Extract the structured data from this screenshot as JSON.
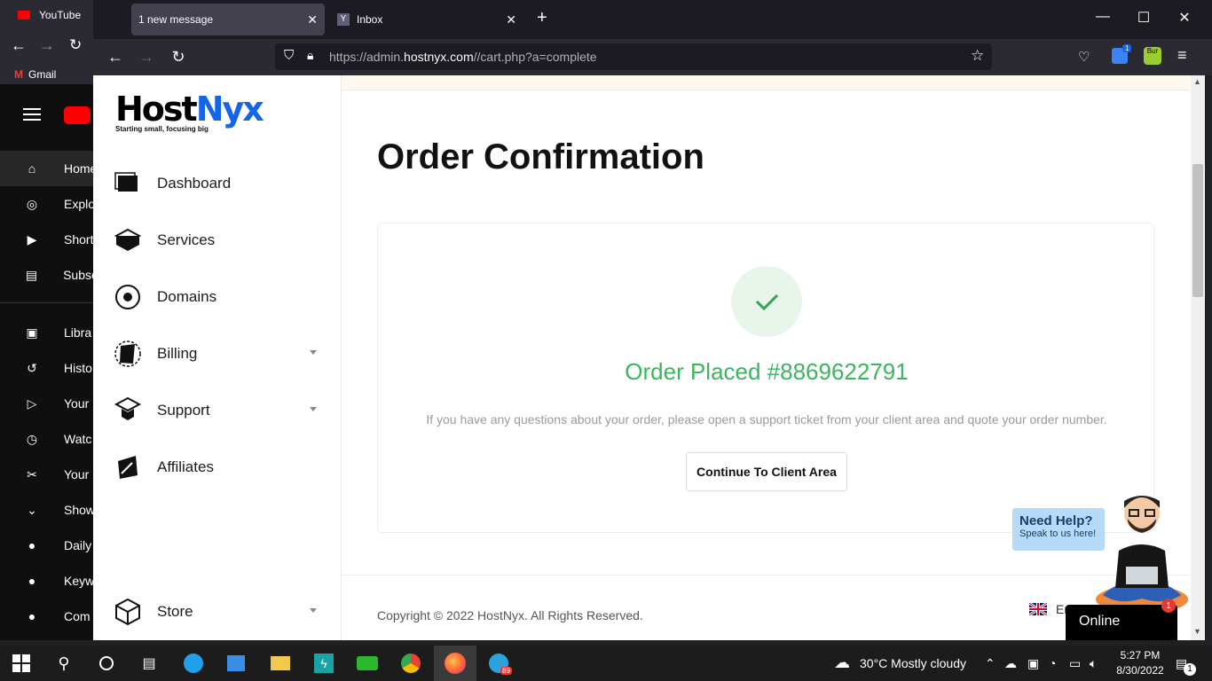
{
  "youtube": {
    "tab_label": "YouTube",
    "bookmark": "Gmail",
    "nav": [
      {
        "label": "Home",
        "icon": "home-icon"
      },
      {
        "label": "Explo",
        "icon": "compass-icon"
      },
      {
        "label": "Short",
        "icon": "shorts-icon"
      },
      {
        "label": "Subsc",
        "icon": "subscriptions-icon"
      },
      {
        "label": "Libra",
        "icon": "library-icon"
      },
      {
        "label": "Histo",
        "icon": "history-icon"
      },
      {
        "label": "Your",
        "icon": "play-icon"
      },
      {
        "label": "Watc",
        "icon": "clock-icon"
      },
      {
        "label": "Your",
        "icon": "scissors-icon"
      },
      {
        "label": "Show",
        "icon": "chevron-down-icon"
      },
      {
        "label": "Daily",
        "icon": "channel-icon"
      },
      {
        "label": "Keyw",
        "icon": "channel-icon"
      },
      {
        "label": "Com",
        "icon": "channel-icon"
      }
    ]
  },
  "browser": {
    "tabs": [
      {
        "label": "1 new message",
        "active": true
      },
      {
        "label": "Inbox",
        "active": false
      }
    ],
    "url_prefix": "https://admin.",
    "url_domain": "hostnyx.com",
    "url_suffix": "//cart.php?a=complete",
    "ext_badge": "1",
    "profile_label": "Bur"
  },
  "site": {
    "logo_main": "Host",
    "logo_accent": "Nyx",
    "logo_tagline": "Starting small, focusing big",
    "menu": [
      {
        "label": "Dashboard",
        "icon": "dashboard-icon",
        "has_caret": false
      },
      {
        "label": "Services",
        "icon": "services-icon",
        "has_caret": false
      },
      {
        "label": "Domains",
        "icon": "domains-icon",
        "has_caret": false
      },
      {
        "label": "Billing",
        "icon": "billing-icon",
        "has_caret": true
      },
      {
        "label": "Support",
        "icon": "support-icon",
        "has_caret": true
      },
      {
        "label": "Affiliates",
        "icon": "affiliates-icon",
        "has_caret": false
      }
    ],
    "store_label": "Store"
  },
  "main": {
    "title": "Order Confirmation",
    "order_placed": "Order Placed #8869622791",
    "description": "If you have any questions about your order, please open a support ticket from your client area and quote your order number.",
    "cta": "Continue To Client Area",
    "copyright": "Copyright © 2022 HostNyx. All Rights Reserved.",
    "language": "Engl"
  },
  "help": {
    "title": "Need Help?",
    "subtitle": "Speak to us here!",
    "status": "Online",
    "badge": "1"
  },
  "taskbar": {
    "weather": "30°C  Mostly cloudy",
    "time": "5:27 PM",
    "date": "8/30/2022",
    "telegram_badge": "89",
    "notif_count": "1"
  },
  "colors": {
    "accent_blue": "#1565e6",
    "success_green": "#3cb55e"
  }
}
